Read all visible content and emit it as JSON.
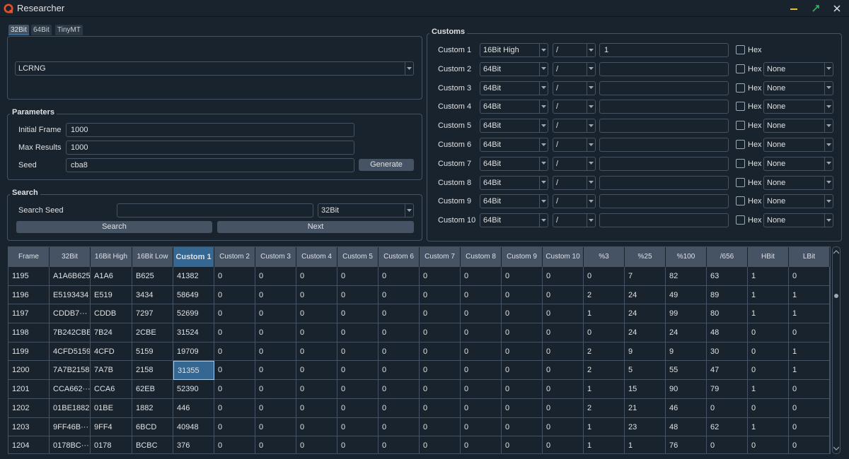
{
  "window": {
    "title": "Researcher"
  },
  "tabs": [
    "32Bit",
    "64Bit",
    "TinyMT"
  ],
  "rng": {
    "selected": "LCRNG"
  },
  "parameters": {
    "title": "Parameters",
    "initial_frame_label": "Initial Frame",
    "initial_frame": "1000",
    "max_results_label": "Max Results",
    "max_results": "1000",
    "seed_label": "Seed",
    "seed": "cba8",
    "generate_label": "Generate"
  },
  "search": {
    "title": "Search",
    "search_seed_label": "Search Seed",
    "search_seed": "",
    "type": "32Bit",
    "search_label": "Search",
    "next_label": "Next"
  },
  "customs": {
    "title": "Customs",
    "hex_label": "Hex",
    "rows": [
      {
        "label": "Custom 1",
        "source": "16Bit High",
        "op": "/",
        "value": "1",
        "ref": ""
      },
      {
        "label": "Custom 2",
        "source": "64Bit",
        "op": "/",
        "value": "",
        "ref": "None"
      },
      {
        "label": "Custom 3",
        "source": "64Bit",
        "op": "/",
        "value": "",
        "ref": "None"
      },
      {
        "label": "Custom 4",
        "source": "64Bit",
        "op": "/",
        "value": "",
        "ref": "None"
      },
      {
        "label": "Custom 5",
        "source": "64Bit",
        "op": "/",
        "value": "",
        "ref": "None"
      },
      {
        "label": "Custom 6",
        "source": "64Bit",
        "op": "/",
        "value": "",
        "ref": "None"
      },
      {
        "label": "Custom 7",
        "source": "64Bit",
        "op": "/",
        "value": "",
        "ref": "None"
      },
      {
        "label": "Custom 8",
        "source": "64Bit",
        "op": "/",
        "value": "",
        "ref": "None"
      },
      {
        "label": "Custom 9",
        "source": "64Bit",
        "op": "/",
        "value": "",
        "ref": "None"
      },
      {
        "label": "Custom 10",
        "source": "64Bit",
        "op": "/",
        "value": "",
        "ref": "None"
      }
    ]
  },
  "table": {
    "headers": [
      "Frame",
      "32Bit",
      "16Bit High",
      "16Bit Low",
      "Custom 1",
      "Custom 2",
      "Custom 3",
      "Custom 4",
      "Custom 5",
      "Custom 6",
      "Custom 7",
      "Custom 8",
      "Custom 9",
      "Custom 10",
      "%3",
      "%25",
      "%100",
      "/656",
      "HBit",
      "LBit"
    ],
    "selected_col": 4,
    "selected_row": 5,
    "rows": [
      [
        "1195",
        "A1A6B625",
        "A1A6",
        "B625",
        "41382",
        "0",
        "0",
        "0",
        "0",
        "0",
        "0",
        "0",
        "0",
        "0",
        "0",
        "7",
        "82",
        "63",
        "1",
        "0"
      ],
      [
        "1196",
        "E5193434",
        "E519",
        "3434",
        "58649",
        "0",
        "0",
        "0",
        "0",
        "0",
        "0",
        "0",
        "0",
        "0",
        "2",
        "24",
        "49",
        "89",
        "1",
        "1"
      ],
      [
        "1197",
        "CDDB7···",
        "CDDB",
        "7297",
        "52699",
        "0",
        "0",
        "0",
        "0",
        "0",
        "0",
        "0",
        "0",
        "0",
        "1",
        "24",
        "99",
        "80",
        "1",
        "1"
      ],
      [
        "1198",
        "7B242CBE",
        "7B24",
        "2CBE",
        "31524",
        "0",
        "0",
        "0",
        "0",
        "0",
        "0",
        "0",
        "0",
        "0",
        "0",
        "24",
        "24",
        "48",
        "0",
        "0"
      ],
      [
        "1199",
        "4CFD5159",
        "4CFD",
        "5159",
        "19709",
        "0",
        "0",
        "0",
        "0",
        "0",
        "0",
        "0",
        "0",
        "0",
        "2",
        "9",
        "9",
        "30",
        "0",
        "1"
      ],
      [
        "1200",
        "7A7B2158",
        "7A7B",
        "2158",
        "31355",
        "0",
        "0",
        "0",
        "0",
        "0",
        "0",
        "0",
        "0",
        "0",
        "2",
        "5",
        "55",
        "47",
        "0",
        "1"
      ],
      [
        "1201",
        "CCA662···",
        "CCA6",
        "62EB",
        "52390",
        "0",
        "0",
        "0",
        "0",
        "0",
        "0",
        "0",
        "0",
        "0",
        "1",
        "15",
        "90",
        "79",
        "1",
        "0"
      ],
      [
        "1202",
        "01BE1882",
        "01BE",
        "1882",
        "446",
        "0",
        "0",
        "0",
        "0",
        "0",
        "0",
        "0",
        "0",
        "0",
        "2",
        "21",
        "46",
        "0",
        "0",
        "0"
      ],
      [
        "1203",
        "9FF46B···",
        "9FF4",
        "6BCD",
        "40948",
        "0",
        "0",
        "0",
        "0",
        "0",
        "0",
        "0",
        "0",
        "0",
        "1",
        "23",
        "48",
        "62",
        "1",
        "0"
      ],
      [
        "1204",
        "0178BC···",
        "0178",
        "BCBC",
        "376",
        "0",
        "0",
        "0",
        "0",
        "0",
        "0",
        "0",
        "0",
        "0",
        "1",
        "1",
        "76",
        "0",
        "0",
        "0"
      ]
    ]
  },
  "colors": {
    "background": "#19232d",
    "border": "#455364",
    "accent": "#346792",
    "logo": "#e8512b"
  }
}
